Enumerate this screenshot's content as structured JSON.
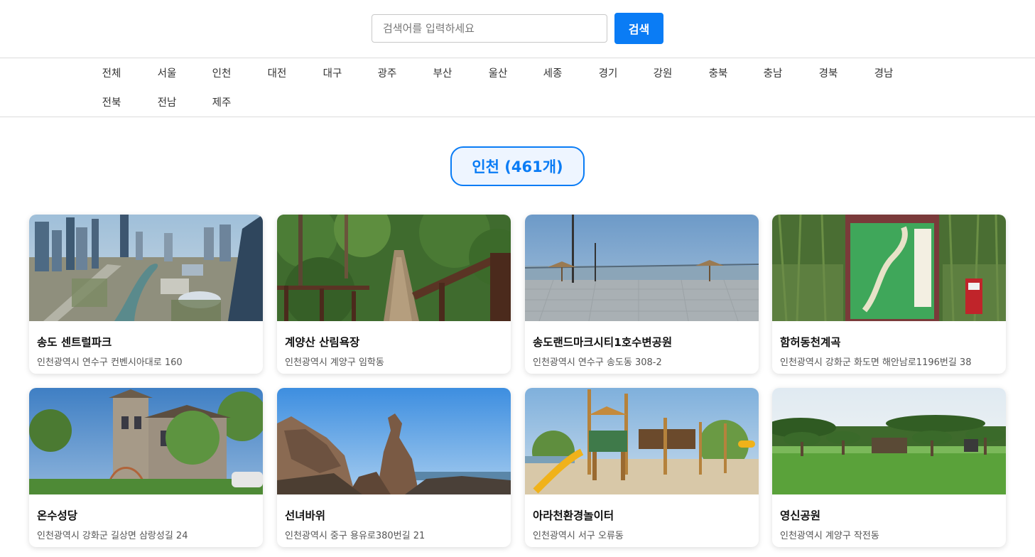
{
  "search": {
    "placeholder": "검색어를 입력하세요",
    "value": "",
    "button_label": "검색"
  },
  "regions": [
    "전체",
    "서울",
    "인천",
    "대전",
    "대구",
    "광주",
    "부산",
    "울산",
    "세종",
    "경기",
    "강원",
    "충북",
    "충남",
    "경북",
    "경남",
    "전북",
    "전남",
    "제주"
  ],
  "selected_region": "인천",
  "main": {
    "title": "인천 (461개)"
  },
  "places": [
    {
      "name": "송도 센트럴파크",
      "address": "인천광역시 연수구 컨벤시아대로 160",
      "image": "city-skyline-park"
    },
    {
      "name": "계양산 산림욕장",
      "address": "인천광역시 계양구 임학동",
      "image": "forest-trail-stairs"
    },
    {
      "name": "송도랜드마크시티1호수변공원",
      "address": "인천광역시 연수구 송도동 308-2",
      "image": "waterfront-plaza-bridge"
    },
    {
      "name": "함허동천계곡",
      "address": "인천광역시 강화군 화도면 해안남로1196번길 38",
      "image": "trail-map-signboard"
    },
    {
      "name": "온수성당",
      "address": "인천광역시 강화군 길상면 삼랑성길 24",
      "image": "stone-church-building"
    },
    {
      "name": "선녀바위",
      "address": "인천광역시 중구 용유로380번길 21",
      "image": "coastal-rock-formation"
    },
    {
      "name": "아라천환경놀이터",
      "address": "인천광역시 서구 오류동",
      "image": "wooden-playground"
    },
    {
      "name": "영신공원",
      "address": "인천광역시 계양구 작전동",
      "image": "green-lawn-park"
    }
  ],
  "colors": {
    "accent": "#0a7cf5",
    "title_bg": "#eef5ff"
  }
}
